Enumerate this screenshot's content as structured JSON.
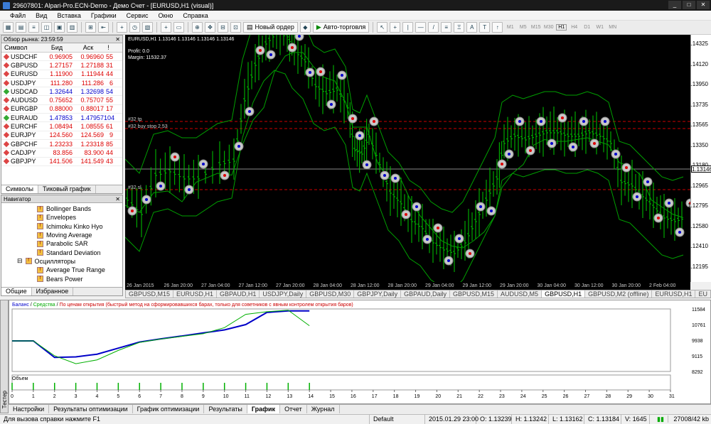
{
  "window": {
    "title": "29607801: Alpari-Pro.ECN-Demo - Демо Счет - [EURUSD,H1 (visual)]"
  },
  "menu": [
    "Файл",
    "Вид",
    "Вставка",
    "Графики",
    "Сервис",
    "Окно",
    "Справка"
  ],
  "toolbar": {
    "new_order": "Новый ордер",
    "auto_trading": "Авто-торговля",
    "timeframes": [
      "M1",
      "M5",
      "M15",
      "M30",
      "H1",
      "H4",
      "D1",
      "W1",
      "MN"
    ]
  },
  "market_watch": {
    "title": "Обзор рынка: 23:59:59",
    "headers": {
      "symbol": "Символ",
      "bid": "Бид",
      "ask": "Аск",
      "spread": "!"
    },
    "rows": [
      {
        "symbol": "USDCHF",
        "bid": "0.96905",
        "ask": "0.96960",
        "spread": "55",
        "dir": "down"
      },
      {
        "symbol": "GBPUSD",
        "bid": "1.27157",
        "ask": "1.27188",
        "spread": "31",
        "dir": "down"
      },
      {
        "symbol": "EURUSD",
        "bid": "1.11900",
        "ask": "1.11944",
        "spread": "44",
        "dir": "down"
      },
      {
        "symbol": "USDJPY",
        "bid": "111.280",
        "ask": "111.286",
        "spread": "6",
        "dir": "down"
      },
      {
        "symbol": "USDCAD",
        "bid": "1.32644",
        "ask": "1.32698",
        "spread": "54",
        "dir": "up"
      },
      {
        "symbol": "AUDUSD",
        "bid": "0.75652",
        "ask": "0.75707",
        "spread": "55",
        "dir": "down"
      },
      {
        "symbol": "EURGBP",
        "bid": "0.88000",
        "ask": "0.88017",
        "spread": "17",
        "dir": "down"
      },
      {
        "symbol": "EURAUD",
        "bid": "1.47853",
        "ask": "1.47957",
        "spread": "104",
        "dir": "up"
      },
      {
        "symbol": "EURCHF",
        "bid": "1.08494",
        "ask": "1.08555",
        "spread": "61",
        "dir": "down"
      },
      {
        "symbol": "EURJPY",
        "bid": "124.560",
        "ask": "124.569",
        "spread": "9",
        "dir": "down"
      },
      {
        "symbol": "GBPCHF",
        "bid": "1.23233",
        "ask": "1.23318",
        "spread": "85",
        "dir": "down"
      },
      {
        "symbol": "CADJPY",
        "bid": "83.856",
        "ask": "83.900",
        "spread": "44",
        "dir": "down"
      },
      {
        "symbol": "GBPJPY",
        "bid": "141.506",
        "ask": "141.549",
        "spread": "43",
        "dir": "down"
      }
    ],
    "tabs": [
      "Символы",
      "Тиковый график"
    ]
  },
  "navigator": {
    "title": "Навигатор",
    "items": [
      "Bollinger Bands",
      "Envelopes",
      "Ichimoku Kinko Hyo",
      "Moving Average",
      "Parabolic SAR",
      "Standard Deviation"
    ],
    "group": "Осцилляторы",
    "group_items": [
      "Average True Range",
      "Bears Power",
      "Bulls Power"
    ],
    "tabs": [
      "Общие",
      "Избранное"
    ]
  },
  "chart": {
    "header": "EURUSD,H1  1.13146 1.13146 1.13146 1.13146",
    "profit": "Profit: 0.0",
    "margin": "Margin: 11532.37",
    "label_tp": "#32 tp",
    "label_buystop": "#32 buy stop 2.53",
    "label_sl": "#32 sl",
    "current_price": "1.13146",
    "prices": [
      "1.14325",
      "1.14120",
      "1.13950",
      "1.13735",
      "1.13565",
      "1.13350",
      "1.13180",
      "1.12965",
      "1.12795",
      "1.12580",
      "1.12410",
      "1.12195"
    ],
    "time_labels": [
      "26 Jan 2015",
      "26 Jan 20:00",
      "27 Jan 04:00",
      "27 Jan 12:00",
      "27 Jan 20:00",
      "28 Jan 04:00",
      "28 Jan 12:00",
      "28 Jan 20:00",
      "29 Jan 04:00",
      "29 Jan 12:00",
      "29 Jan 20:00",
      "30 Jan 04:00",
      "30 Jan 12:00",
      "30 Jan 20:00",
      "2 Feb 04:00"
    ],
    "colors": {
      "bg": "#000000",
      "candle": "#00c800",
      "ma": "#00a000",
      "marker": "#c8c8c8"
    }
  },
  "chart_tabs": [
    "GBPUSD,M15",
    "EURUSD,H1",
    "GBPAUD,H1",
    "USDJPY,Daily",
    "GBPUSD,M30",
    "GBPJPY,Daily",
    "GBPAUD,Daily",
    "GBPUSD,M15",
    "AUDUSD,M5",
    "GBPUSD,H1",
    "GBPUSD,M2 (offline)",
    "EURUSD,H1",
    "EU"
  ],
  "tester": {
    "vertical_label": "Тестер",
    "legend_balance": "Баланс",
    "legend_equity": "Средства",
    "legend_rest": "По ценам открытия (быстрый метод на сформировавшихся барах, только для советников с явным контролем открытия баров)",
    "volume_label": "Объем",
    "y_ticks": [
      "11584",
      "10761",
      "9938",
      "9115",
      "8292"
    ],
    "x_ticks": [
      "0",
      "1",
      "2",
      "3",
      "4",
      "5",
      "6",
      "7",
      "8",
      "9",
      "10",
      "11",
      "12",
      "13",
      "14",
      "15",
      "16",
      "17",
      "18",
      "19",
      "20",
      "21",
      "22",
      "23",
      "24",
      "25",
      "26",
      "27",
      "28",
      "29",
      "30",
      "31"
    ],
    "tabs": [
      "Настройки",
      "Результаты оптимизации",
      "График оптимизации",
      "Результаты",
      "График",
      "Отчет",
      "Журнал"
    ],
    "active_tab": "График",
    "chart_data": {
      "type": "line",
      "x": [
        0,
        1,
        2,
        3,
        4,
        5,
        6,
        7,
        8,
        9,
        10,
        11,
        12,
        13,
        14
      ],
      "series": [
        {
          "name": "Баланс",
          "values": [
            9900,
            9900,
            9030,
            9060,
            9200,
            9520,
            9840,
            10010,
            10160,
            10320,
            10480,
            10760,
            11400,
            11480,
            11480
          ],
          "color": "#0000c8"
        },
        {
          "name": "Средства",
          "values": [
            9900,
            9900,
            9120,
            8700,
            8900,
            9400,
            9820,
            10000,
            10140,
            10280,
            10600,
            11300,
            11440,
            11520,
            10700
          ],
          "color": "#00b000"
        }
      ],
      "volume": [
        1,
        1,
        1,
        1,
        1,
        1,
        1,
        1,
        1,
        1,
        1,
        1,
        1,
        1,
        1
      ],
      "ylim": [
        8292,
        11584
      ],
      "xlim": [
        0,
        31
      ]
    }
  },
  "status": {
    "help": "Для вызова справки нажмите F1",
    "profile": "Default",
    "time": "2015.01.29 23:00",
    "open": "O: 1.13239",
    "high": "H: 1.13242",
    "low": "L: 1.13162",
    "close": "C: 1.13184",
    "volume": "V: 1645",
    "traffic": "27008/42 kb"
  }
}
